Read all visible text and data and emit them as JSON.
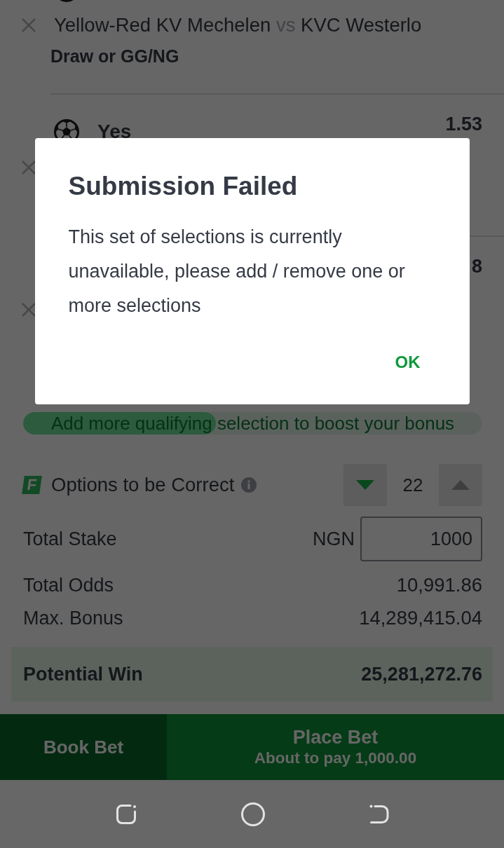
{
  "selections": [
    {
      "match": {
        "home": "Yellow-Red KV Mechelen",
        "vs": "vs",
        "away": "KVC Westerlo"
      },
      "market": "Draw or GG/NG"
    },
    {
      "pick": "Yes",
      "odds": "1.53"
    },
    {
      "odds": "8"
    }
  ],
  "bonus_progress": {
    "text": "Add more qualifying selection to boost your bonus",
    "level": 0.42
  },
  "options": {
    "badge": "F",
    "label": "Options to be Correct",
    "value": "22",
    "decrease": {
      "disabled": false
    },
    "increase": {
      "disabled": true
    }
  },
  "total_stake": {
    "label": "Total Stake",
    "currency": "NGN",
    "value": "1000"
  },
  "summary": [
    {
      "label": "Total Odds",
      "value": "10,991.86"
    },
    {
      "label": "Max. Bonus",
      "value": "14,289,415.04"
    }
  ],
  "potential_win": {
    "label": "Potential Win",
    "value": "25,281,272.76"
  },
  "actions": {
    "book_bet": "Book Bet",
    "place_bet": {
      "label": "Place Bet",
      "subtitle": "About to pay 1,000.00"
    }
  },
  "dialog": {
    "title": "Submission Failed",
    "message": "This set of selections is currently unavailable, please add / remove one or more selections",
    "button": "OK"
  }
}
